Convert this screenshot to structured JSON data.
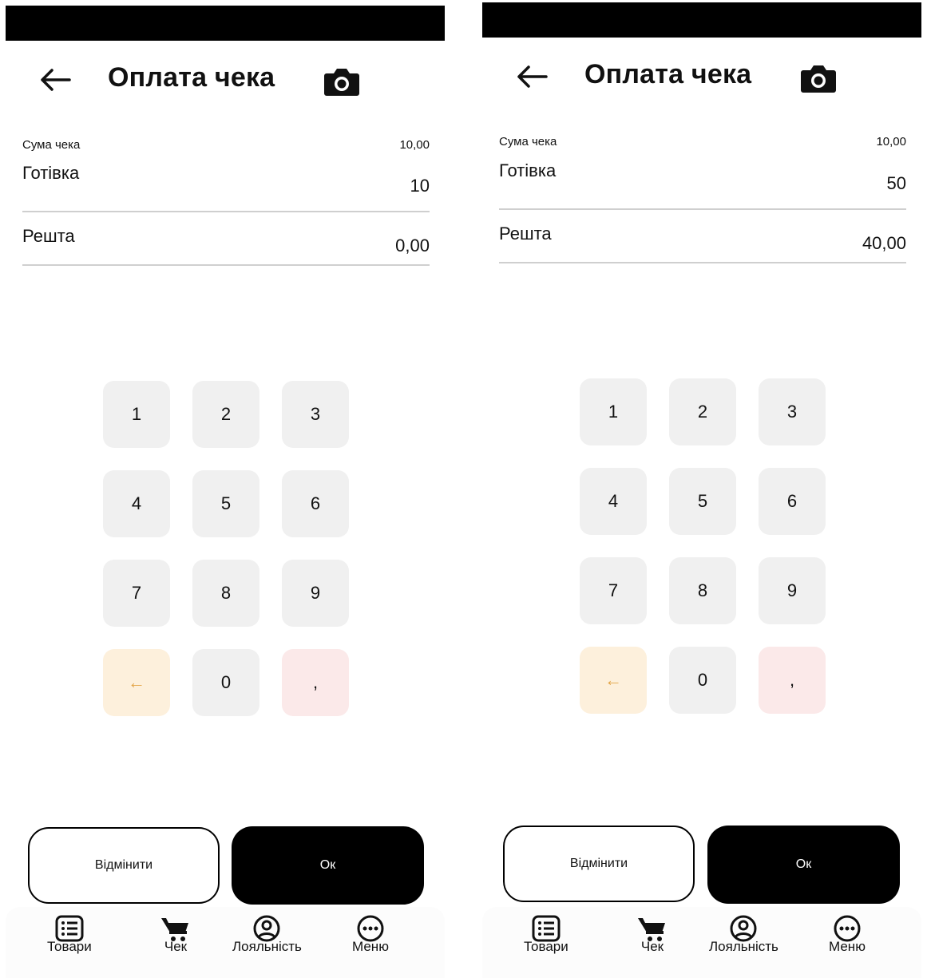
{
  "screens": [
    {
      "header": {
        "title": "Оплата чека"
      },
      "receipt_sum": {
        "label": "Сума чека",
        "value": "10,00"
      },
      "cash": {
        "label": "Готівка",
        "value": "10"
      },
      "change": {
        "label": "Решта",
        "value": "0,00"
      },
      "keypad": [
        "1",
        "2",
        "3",
        "4",
        "5",
        "6",
        "7",
        "8",
        "9",
        "←",
        "0",
        ","
      ],
      "buttons": {
        "cancel": "Відмінити",
        "ok": "Ок"
      },
      "nav": {
        "goods": "Товари",
        "check": "Чек",
        "loyalty": "Лояльність",
        "menu": "Меню"
      }
    },
    {
      "header": {
        "title": "Оплата чека"
      },
      "receipt_sum": {
        "label": "Сума чека",
        "value": "10,00"
      },
      "cash": {
        "label": "Готівка",
        "value": "50"
      },
      "change": {
        "label": "Решта",
        "value": "40,00"
      },
      "keypad": [
        "1",
        "2",
        "3",
        "4",
        "5",
        "6",
        "7",
        "8",
        "9",
        "←",
        "0",
        ","
      ],
      "buttons": {
        "cancel": "Відмінити",
        "ok": "Ок"
      },
      "nav": {
        "goods": "Товари",
        "check": "Чек",
        "loyalty": "Лояльність",
        "menu": "Меню"
      }
    }
  ],
  "colors": {
    "status_bar": "#000000",
    "key_default": "#f0f0f0",
    "key_backspace": "#fdf0dc",
    "key_backspace_glyph": "#e3a548",
    "key_comma": "#fbe9e9",
    "ok_button": "#000000"
  },
  "icons": {
    "back": "arrow-left-icon",
    "camera": "camera-icon",
    "goods": "list-icon",
    "check": "cart-icon",
    "loyalty": "user-circle-icon",
    "menu": "more-circle-icon"
  }
}
